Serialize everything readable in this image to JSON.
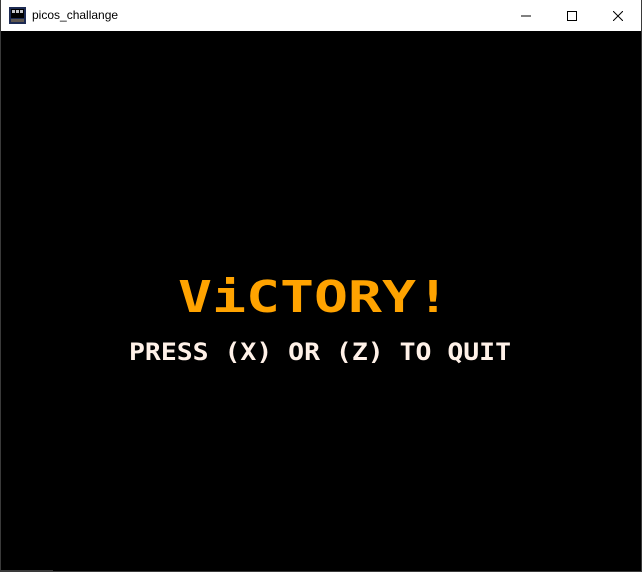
{
  "window": {
    "title": "picos_challange",
    "icons": {
      "app": "pico-app-icon",
      "minimize": "minimize-icon",
      "maximize": "maximize-icon",
      "close": "close-icon"
    }
  },
  "game": {
    "headline": "ViCTORY!",
    "instruction": "PRESS (X) OR (Z) TO QUIT",
    "colors": {
      "background": "#000000",
      "headline": "#ffa300",
      "headline_shadow": "#ffec27",
      "instruction": "#fff1e8"
    }
  }
}
